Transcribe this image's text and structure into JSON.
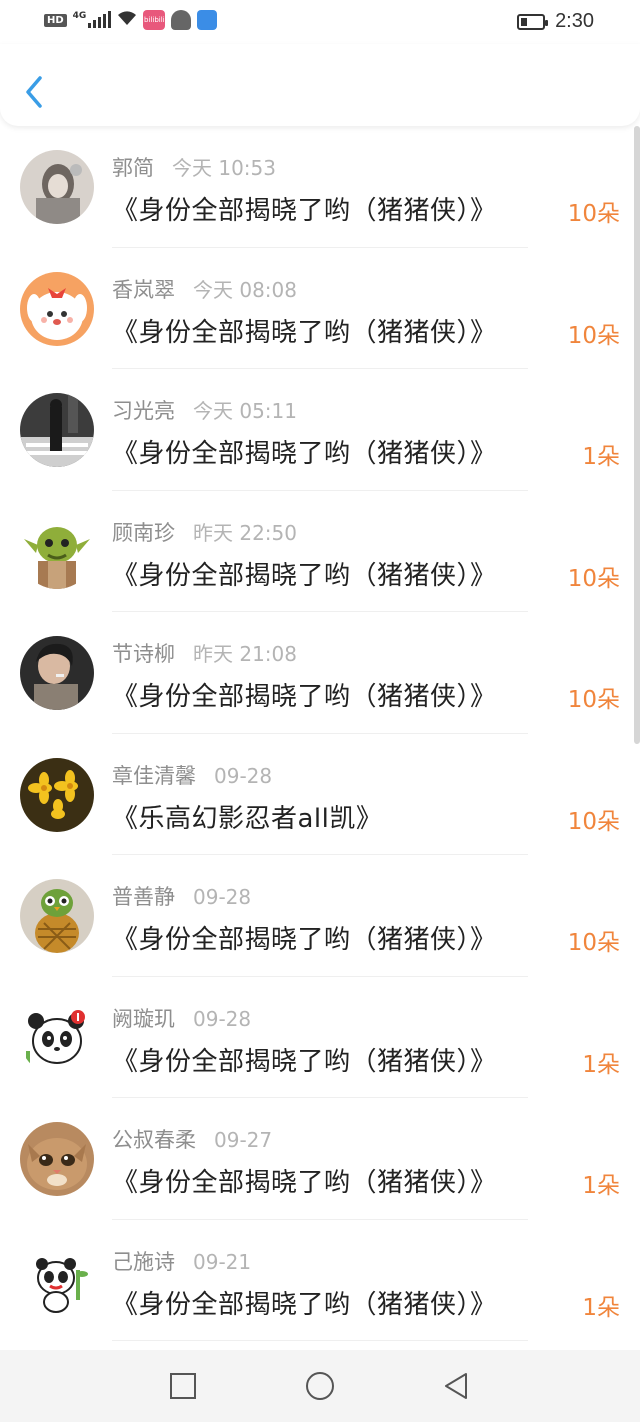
{
  "status_bar": {
    "hd": "HD",
    "network": "4G",
    "app_badge": "bilibili",
    "time": "2:30"
  },
  "nav": {
    "back_icon": "chevron-left-icon"
  },
  "colors": {
    "accent": "#f0853c",
    "back": "#3a9de6"
  },
  "items": [
    {
      "name": "郭简",
      "time": "今天 10:53",
      "title": "《身份全部揭晓了哟（猪猪侠）》",
      "count": "10朵"
    },
    {
      "name": "香岚翠",
      "time": "今天 08:08",
      "title": "《身份全部揭晓了哟（猪猪侠）》",
      "count": "10朵"
    },
    {
      "name": "习光亮",
      "time": "今天 05:11",
      "title": "《身份全部揭晓了哟（猪猪侠）》",
      "count": "1朵"
    },
    {
      "name": "顾南珍",
      "time": "昨天 22:50",
      "title": "《身份全部揭晓了哟（猪猪侠）》",
      "count": "10朵"
    },
    {
      "name": "节诗柳",
      "time": "昨天 21:08",
      "title": "《身份全部揭晓了哟（猪猪侠）》",
      "count": "10朵"
    },
    {
      "name": "章佳清馨",
      "time": "09-28",
      "title": "《乐高幻影忍者all凯》",
      "count": "10朵"
    },
    {
      "name": "普善静",
      "time": "09-28",
      "title": "《身份全部揭晓了哟（猪猪侠）》",
      "count": "10朵"
    },
    {
      "name": "阙璇玑",
      "time": "09-28",
      "title": "《身份全部揭晓了哟（猪猪侠）》",
      "count": "1朵"
    },
    {
      "name": "公叔春柔",
      "time": "09-27",
      "title": "《身份全部揭晓了哟（猪猪侠）》",
      "count": "1朵"
    },
    {
      "name": "己施诗",
      "time": "09-21",
      "title": "《身份全部揭晓了哟（猪猪侠）》",
      "count": "1朵"
    }
  ]
}
